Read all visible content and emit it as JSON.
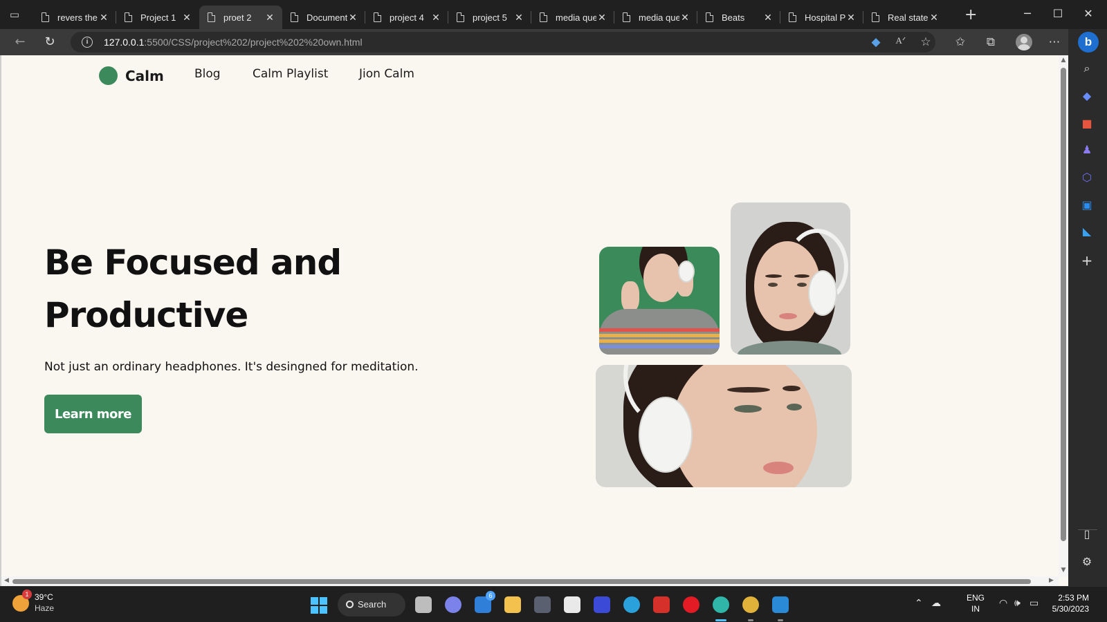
{
  "browser": {
    "tabs": [
      {
        "title": "revers the",
        "active": false
      },
      {
        "title": "Project 1",
        "active": false
      },
      {
        "title": "proet 2",
        "active": true
      },
      {
        "title": "Document",
        "active": false
      },
      {
        "title": "project 4",
        "active": false
      },
      {
        "title": "project 5",
        "active": false
      },
      {
        "title": "media que",
        "active": false
      },
      {
        "title": "media que",
        "active": false
      },
      {
        "title": "Beats",
        "active": false
      },
      {
        "title": "Hospital P",
        "active": false
      },
      {
        "title": "Real state",
        "active": false
      }
    ],
    "url_host": "127.0.0.1",
    "url_path": ":5500/CSS/project%202/project%202%20own.html",
    "icons": {
      "back": "back-arrow-icon",
      "refresh": "refresh-icon",
      "info": "site-info-icon",
      "tag": "price-tag-icon",
      "read_aloud": "read-aloud-icon",
      "add_favorite": "add-favorite-icon",
      "favorites": "favorites-icon",
      "collections": "collections-icon",
      "profile": "profile-icon",
      "more": "more-icon"
    }
  },
  "page": {
    "brand": "Calm",
    "nav": [
      "Blog",
      "Calm Playlist",
      "Jion Calm"
    ],
    "hero_title": "Be Focused and Productive",
    "hero_subtitle": "Not just an ordinary headphones. It's desingned for meditation.",
    "cta_label": "Learn more",
    "colors": {
      "accent": "#3c8a5c",
      "background": "#faf6f0"
    }
  },
  "taskbar": {
    "weather_temp": "39°C",
    "weather_desc": "Haze",
    "weather_badge": "1",
    "search_label": "Search",
    "teams_badge": "6",
    "lang_line1": "ENG",
    "lang_line2": "IN",
    "time": "2:53 PM",
    "date": "5/30/2023"
  }
}
